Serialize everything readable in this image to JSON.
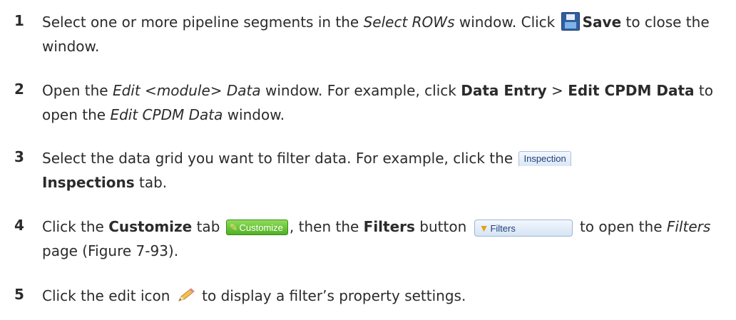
{
  "steps": [
    {
      "num": "1",
      "t1": "Select one or more pipeline segments in the ",
      "t2": "Select ROWs",
      "t3": " window. Click ",
      "t4": "Save",
      "t5": " to close the window.",
      "icon": "save-icon"
    },
    {
      "num": "2",
      "t1": "Open the ",
      "t2": "Edit <module> Data",
      "t3": " window. For example, click ",
      "t4": "Data Entry",
      "t5": " > ",
      "t6": "Edit CPDM Data",
      "t7": " to open the ",
      "t8": "Edit CPDM Data",
      "t9": " window."
    },
    {
      "num": "3",
      "t1": "Select the data grid you want to filter data. For example, click the ",
      "tab_label": "Inspection",
      "t2": "Inspections",
      "t3": " tab."
    },
    {
      "num": "4",
      "t1": "Click the ",
      "t2": "Customize",
      "t3": " tab ",
      "customize_label": "Customize",
      "t4": ", then the ",
      "t5": "Filters",
      "t6": " button ",
      "filters_label": "Filters",
      "t7": " to open the ",
      "t8": "Filters",
      "t9": " page (Figure 7-93)."
    },
    {
      "num": "5",
      "t1": "Click the edit icon ",
      "t2": " to display a filter’s property settings.",
      "icon": "pencil-icon"
    }
  ]
}
